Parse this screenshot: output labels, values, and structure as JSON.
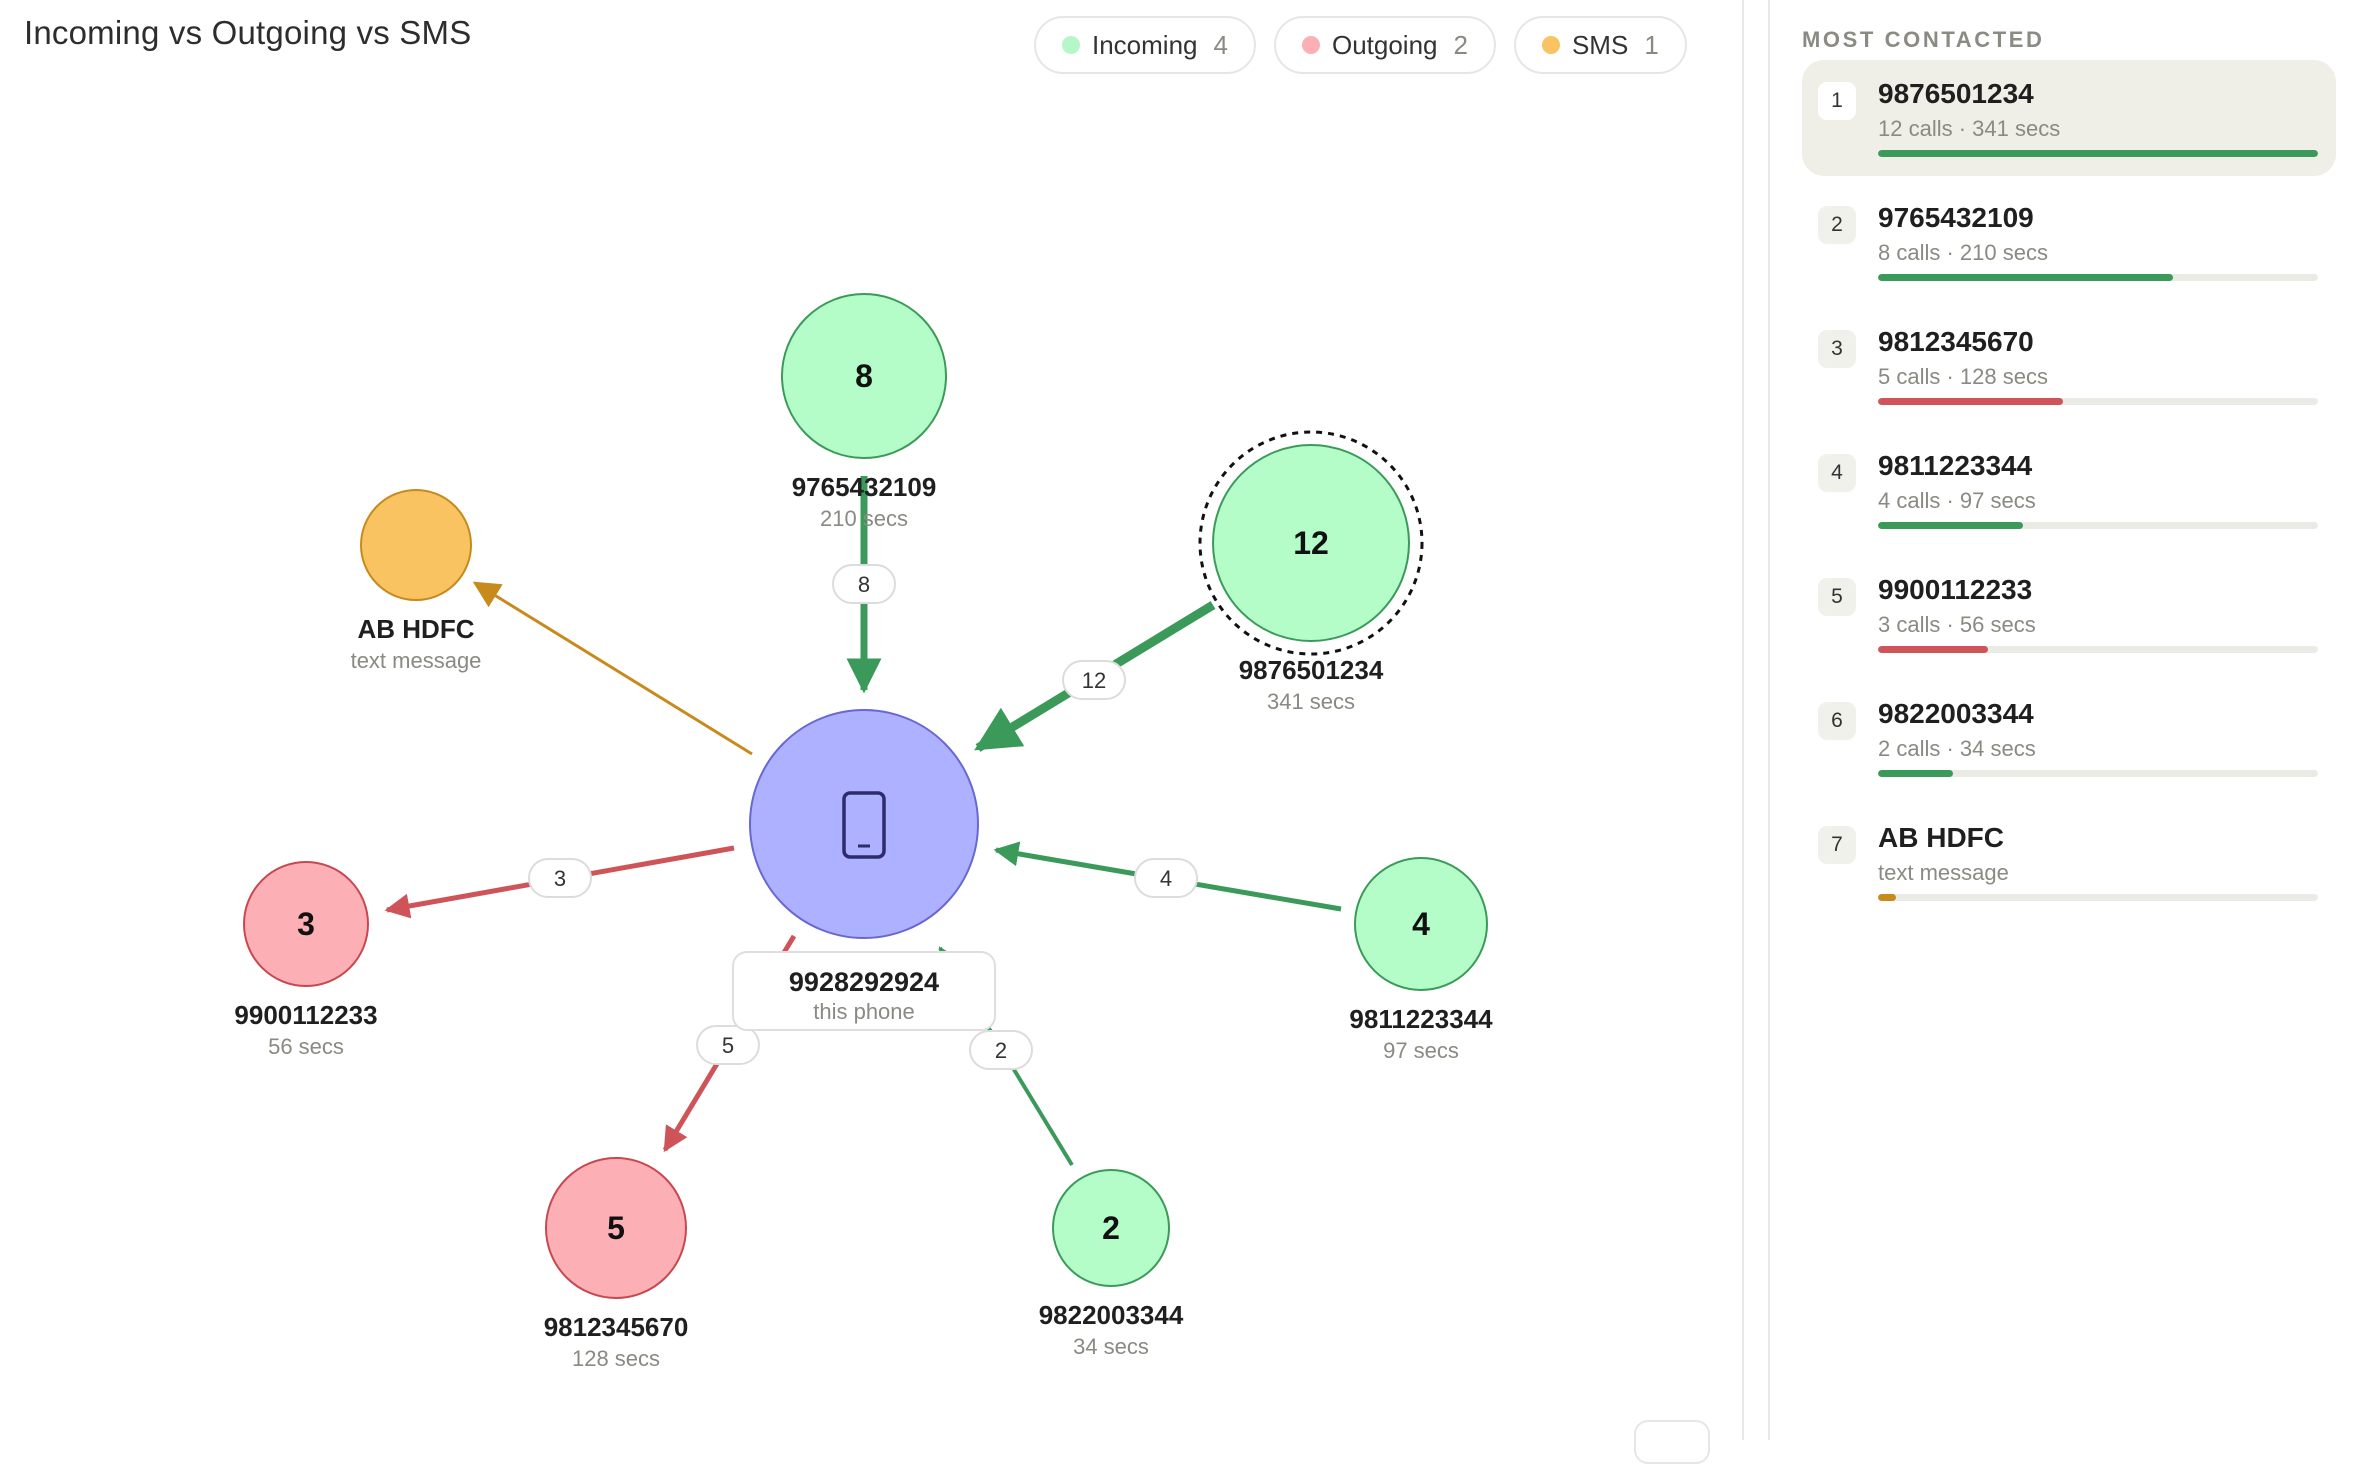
{
  "title": "Incoming vs Outgoing vs SMS",
  "legend": [
    {
      "label": "Incoming",
      "count": "4",
      "color": "#b5f7c8"
    },
    {
      "label": "Outgoing",
      "count": "2",
      "color": "#fcb0b5"
    },
    {
      "label": "SMS",
      "count": "1",
      "color": "#f8c360"
    }
  ],
  "colors": {
    "incoming_fill": "#b5fdc8",
    "incoming_stroke": "#3b9a5a",
    "incoming_edge": "#3b9a5a",
    "outgoing_fill": "#fcb0b5",
    "outgoing_stroke": "#c9484f",
    "outgoing_edge": "#cf5459",
    "sms_fill": "#f8c360",
    "sms_stroke": "#c88a1e",
    "sms_edge": "#c98a1c",
    "center_fill": "#adb1ff",
    "center_stroke": "#6868d4"
  },
  "graph": {
    "center": {
      "number": "9928292924",
      "caption": "this phone",
      "icon": "phone-icon"
    },
    "nodes": [
      {
        "id": "n9765432109",
        "number": "9765432109",
        "detail": "210 secs",
        "count": "8",
        "type": "incoming",
        "edge_label": "8"
      },
      {
        "id": "n9876501234",
        "number": "9876501234",
        "detail": "341 secs",
        "count": "12",
        "type": "incoming",
        "edge_label": "12",
        "highlighted": true
      },
      {
        "id": "n9811223344",
        "number": "9811223344",
        "detail": "97 secs",
        "count": "4",
        "type": "incoming",
        "edge_label": "4"
      },
      {
        "id": "n9822003344",
        "number": "9822003344",
        "detail": "34 secs",
        "count": "2",
        "type": "incoming",
        "edge_label": "2"
      },
      {
        "id": "n9812345670",
        "number": "9812345670",
        "detail": "128 secs",
        "count": "5",
        "type": "outgoing",
        "edge_label": "5"
      },
      {
        "id": "n9900112233",
        "number": "9900112233",
        "detail": "56 secs",
        "count": "3",
        "type": "outgoing",
        "edge_label": "3"
      },
      {
        "id": "nABHDFC",
        "number": "AB HDFC",
        "detail": "text message",
        "count": "",
        "type": "sms",
        "edge_label": ""
      }
    ]
  },
  "sidebar": {
    "heading": "MOST CONTACTED",
    "items": [
      {
        "rank": "1",
        "name": "9876501234",
        "sub": "12 calls · 341 secs",
        "share": 1.0,
        "type": "incoming",
        "selected": true
      },
      {
        "rank": "2",
        "name": "9765432109",
        "sub": "8 calls · 210 secs",
        "share": 0.67,
        "type": "incoming",
        "selected": false
      },
      {
        "rank": "3",
        "name": "9812345670",
        "sub": "5 calls · 128 secs",
        "share": 0.42,
        "type": "outgoing",
        "selected": false
      },
      {
        "rank": "4",
        "name": "9811223344",
        "sub": "4 calls · 97 secs",
        "share": 0.33,
        "type": "incoming",
        "selected": false
      },
      {
        "rank": "5",
        "name": "9900112233",
        "sub": "3 calls · 56 secs",
        "share": 0.25,
        "type": "outgoing",
        "selected": false
      },
      {
        "rank": "6",
        "name": "9822003344",
        "sub": "2 calls · 34 secs",
        "share": 0.17,
        "type": "incoming",
        "selected": false
      },
      {
        "rank": "7",
        "name": "AB HDFC",
        "sub": "text message",
        "share": 0.04,
        "type": "sms",
        "selected": false
      }
    ]
  }
}
